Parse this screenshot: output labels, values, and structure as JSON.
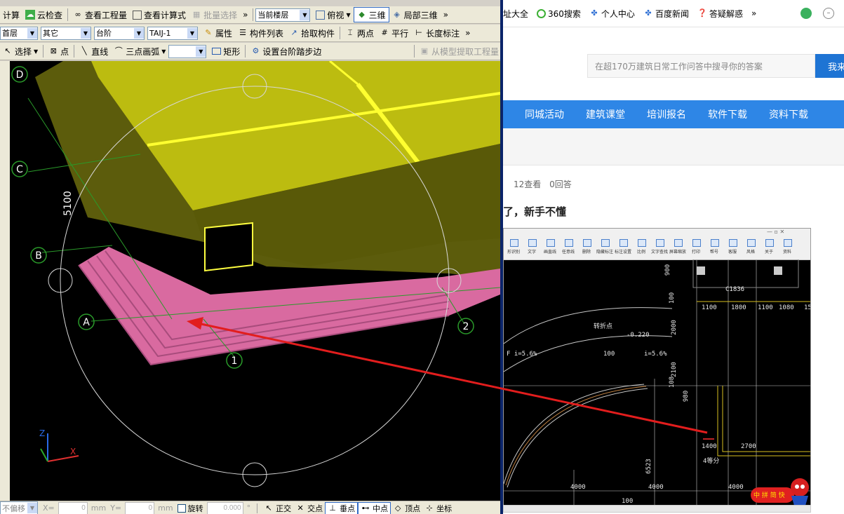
{
  "left_app": {
    "toolbar1": {
      "calc_fragment": "计算",
      "cloud_check": "云检查",
      "view_quantity": "查看工程量",
      "view_formula": "查看计算式",
      "batch_select": "批量选择",
      "current_floor": "当前楼层",
      "view_mode": "俯视",
      "three_d": "三维",
      "local_3d": "局部三维",
      "overflow": "»"
    },
    "toolbar2": {
      "floor_value": "首层",
      "category_value": "其它",
      "element_value": "台阶",
      "code_value": "TAIJ-1",
      "properties": "属性",
      "component_list": "构件列表",
      "pick_component": "拾取构件",
      "two_points": "两点",
      "parallel": "平行",
      "length_mark": "长度标注",
      "overflow": "»"
    },
    "toolbar3": {
      "select": "选择",
      "point": "点",
      "line": "直线",
      "arc3": "三点画弧",
      "rect": "矩形",
      "set_step_edge": "设置台阶踏步边",
      "extract_quantity": "从模型提取工程量"
    },
    "viewport": {
      "axis_labels": [
        "D",
        "C",
        "B",
        "A",
        "1",
        "2"
      ],
      "dimension": "5100",
      "axes": {
        "z": "Z",
        "x": "X"
      }
    },
    "status": {
      "no_offset": "不偏移",
      "x_label": "X=",
      "x_value": "0",
      "mm1": "mm",
      "y_label": "Y=",
      "y_value": "0",
      "mm2": "mm",
      "rotate": "旋转",
      "rotate_value": "0.000",
      "deg": "°",
      "ortho": "正交",
      "intersection": "交点",
      "perpendicular": "垂点",
      "midpoint": "中点",
      "vertex": "顶点",
      "coord": "坐标"
    }
  },
  "browser": {
    "bookmarks": [
      "址大全",
      "360搜索",
      "个人中心",
      "百度新闻",
      "答疑解惑",
      "»"
    ],
    "search": {
      "placeholder": "在超170万建筑日常工作问答中搜寻你的答案",
      "button": "我来"
    },
    "nav": [
      "同城活动",
      "建筑课堂",
      "培训报名",
      "软件下载",
      "资料下载"
    ],
    "question": {
      "views": "12查看",
      "answers": "0回答",
      "title": "了，新手不懂"
    },
    "embedded": {
      "toolbar_labels": [
        "形识别",
        "文字",
        "画直线",
        "任意线",
        "删除",
        "隐藏标注",
        "标注设置",
        "比例",
        "文字查找",
        "屏幕缩放",
        "打印",
        "帮号",
        "客服",
        "风格",
        "关于",
        "资料"
      ],
      "dims": {
        "d900": "900",
        "d700": "100",
        "c1836": "C1836",
        "row1": [
          "1100",
          "1800",
          "1100",
          "1080",
          "15"
        ],
        "d2000": "2000",
        "d_220": "-0.220",
        "turn_point": "转折点",
        "slope1": "F i=5.6%",
        "slope2": "i=5.6%",
        "d100": "100",
        "d2100": "2100",
        "d108": "108",
        "d980": "980",
        "d1400": "1400",
        "d2700": "2700",
        "div4": "4等分",
        "d6523": "6523",
        "bottom": [
          "4000",
          "4000",
          "4000"
        ],
        "d100b": "100"
      },
      "mascot_text": "中 拼 简 快"
    }
  }
}
